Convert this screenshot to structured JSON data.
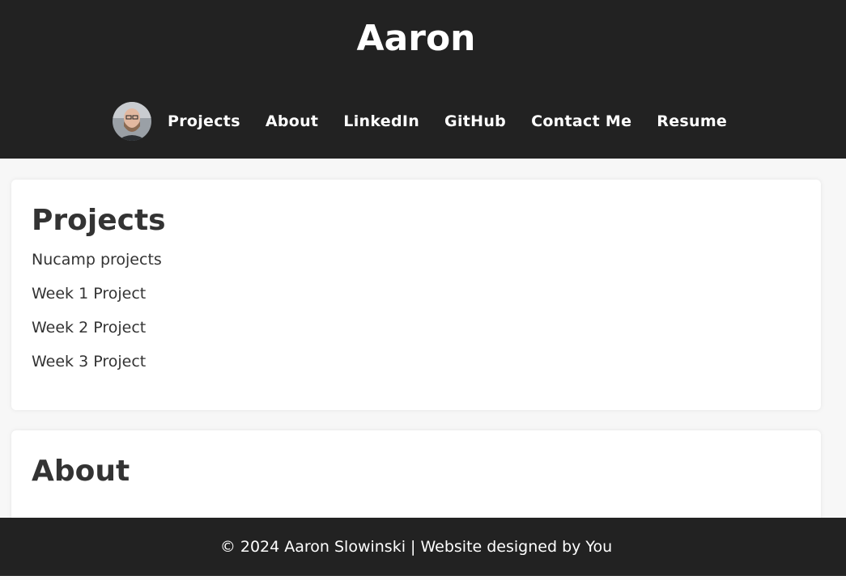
{
  "header": {
    "title": "Aaron"
  },
  "nav": {
    "items": [
      {
        "label": "Projects"
      },
      {
        "label": "About"
      },
      {
        "label": "LinkedIn"
      },
      {
        "label": "GitHub"
      },
      {
        "label": "Contact Me"
      },
      {
        "label": "Resume"
      }
    ],
    "avatar_icon": "profile-photo"
  },
  "projects": {
    "heading": "Projects",
    "items": [
      "Nucamp projects",
      "Week 1 Project",
      "Week 2 Project",
      "Week 3 Project"
    ]
  },
  "about": {
    "heading": "About"
  },
  "footer": {
    "text": "© 2024 Aaron Slowinski | Website designed by You"
  },
  "colors": {
    "header_bg": "#222222",
    "page_bg": "#f7f7f7",
    "card_bg": "#ffffff",
    "text": "#333333"
  }
}
